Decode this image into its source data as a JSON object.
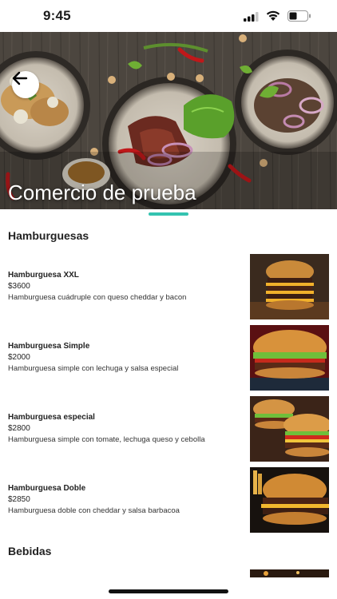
{
  "status": {
    "time": "9:45"
  },
  "store": {
    "name": "Comercio de prueba"
  },
  "sections": [
    {
      "title": "Hamburguesas",
      "items": [
        {
          "name": "Hamburguesa XXL",
          "price": "$3600",
          "description": "Hamburguesa cuádruple con queso cheddar y bacon"
        },
        {
          "name": "Hamburguesa Simple",
          "price": "$2000",
          "description": "Hamburguesa simple con lechuga y salsa especial"
        },
        {
          "name": "Hamburguesa especial",
          "price": "$2800",
          "description": "Hamburguesa simple con tomate, lechuga queso y cebolla"
        },
        {
          "name": "Hamburguesa Doble",
          "price": "$2850",
          "description": "Hamburguesa doble con cheddar y salsa barbacoa"
        }
      ]
    },
    {
      "title": "Bebidas",
      "items": []
    }
  ],
  "colors": {
    "accent": "#34c3b0"
  },
  "icons": {
    "back": "arrow-left-icon"
  }
}
